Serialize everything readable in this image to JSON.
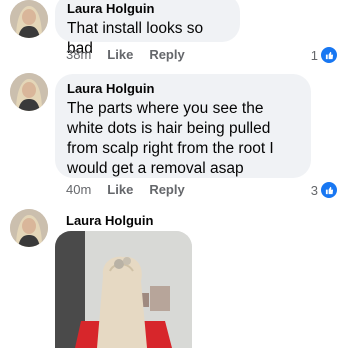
{
  "comments": [
    {
      "author": "Laura Holguin",
      "text": "That install looks so bad",
      "time": "38m",
      "like_label": "Like",
      "reply_label": "Reply",
      "reaction_count": "1"
    },
    {
      "author": "Laura Holguin",
      "text": "The parts where you see the white dots is hair being pulled from scalp right from the root I would get a removal asap",
      "time": "40m",
      "like_label": "Like",
      "reply_label": "Reply",
      "reaction_count": "3"
    },
    {
      "author": "Laura Holguin",
      "attachment": "photo"
    }
  ],
  "colors": {
    "bubble": "#f0f2f5",
    "meta": "#65676b",
    "like_blue": "#1877f2"
  },
  "icons": [
    "avatar",
    "like-icon"
  ]
}
